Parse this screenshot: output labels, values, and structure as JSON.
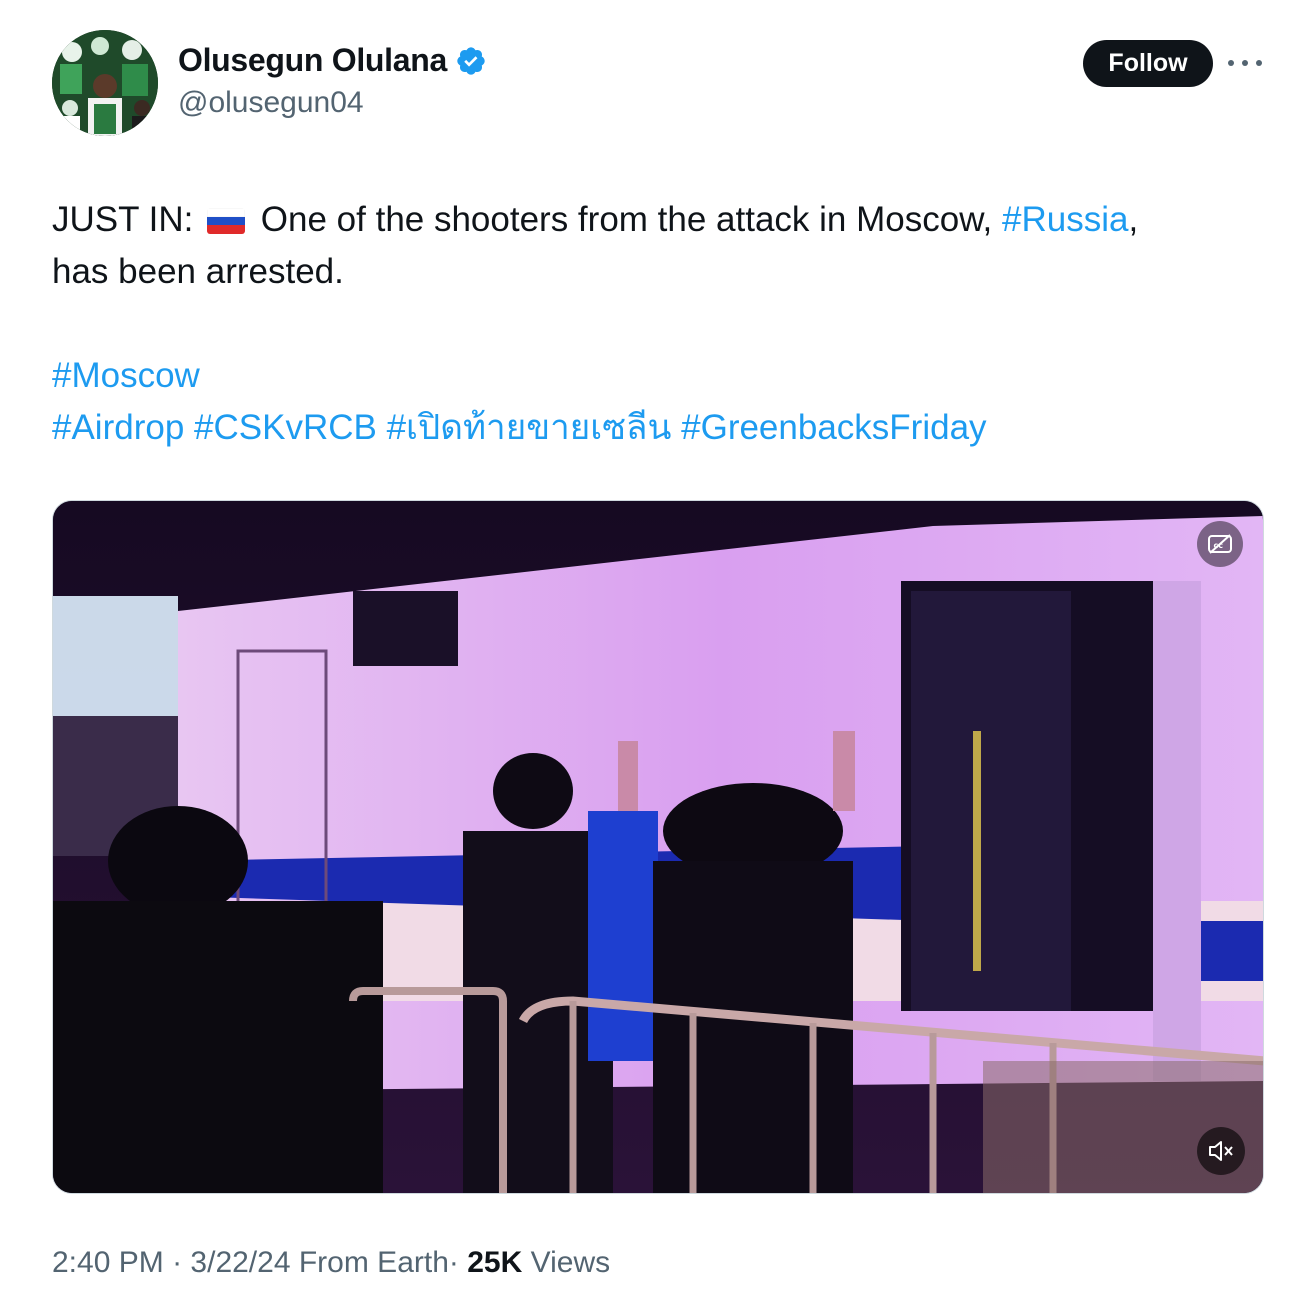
{
  "author": {
    "display_name": "Olusegun Olulana",
    "handle": "@olusegun04",
    "verified": true
  },
  "actions": {
    "follow_label": "Follow",
    "more_icon": "more-horizontal-icon"
  },
  "tweet": {
    "line1_prefix": "JUST IN:",
    "line1_main": "One of the shooters from the attack in Moscow,",
    "hashtag_russia": "#Russia",
    "comma": ",",
    "line2": "has been arrested.",
    "hashtag_moscow": "#Moscow",
    "hashtags": [
      "#Airdrop",
      "#CSKvRCB",
      "#เปิดท้ายขายเซลีน",
      "#GreenbacksFriday"
    ],
    "link_color": "#1d9bf0"
  },
  "media": {
    "captions_icon": "captions-off-icon",
    "mute_icon": "volume-muted-icon"
  },
  "meta": {
    "time": "2:40 PM",
    "sep1": "·",
    "date": "3/22/24",
    "source": "From Earth",
    "sep2": "·",
    "views_count": "25K",
    "views_label": "Views"
  }
}
